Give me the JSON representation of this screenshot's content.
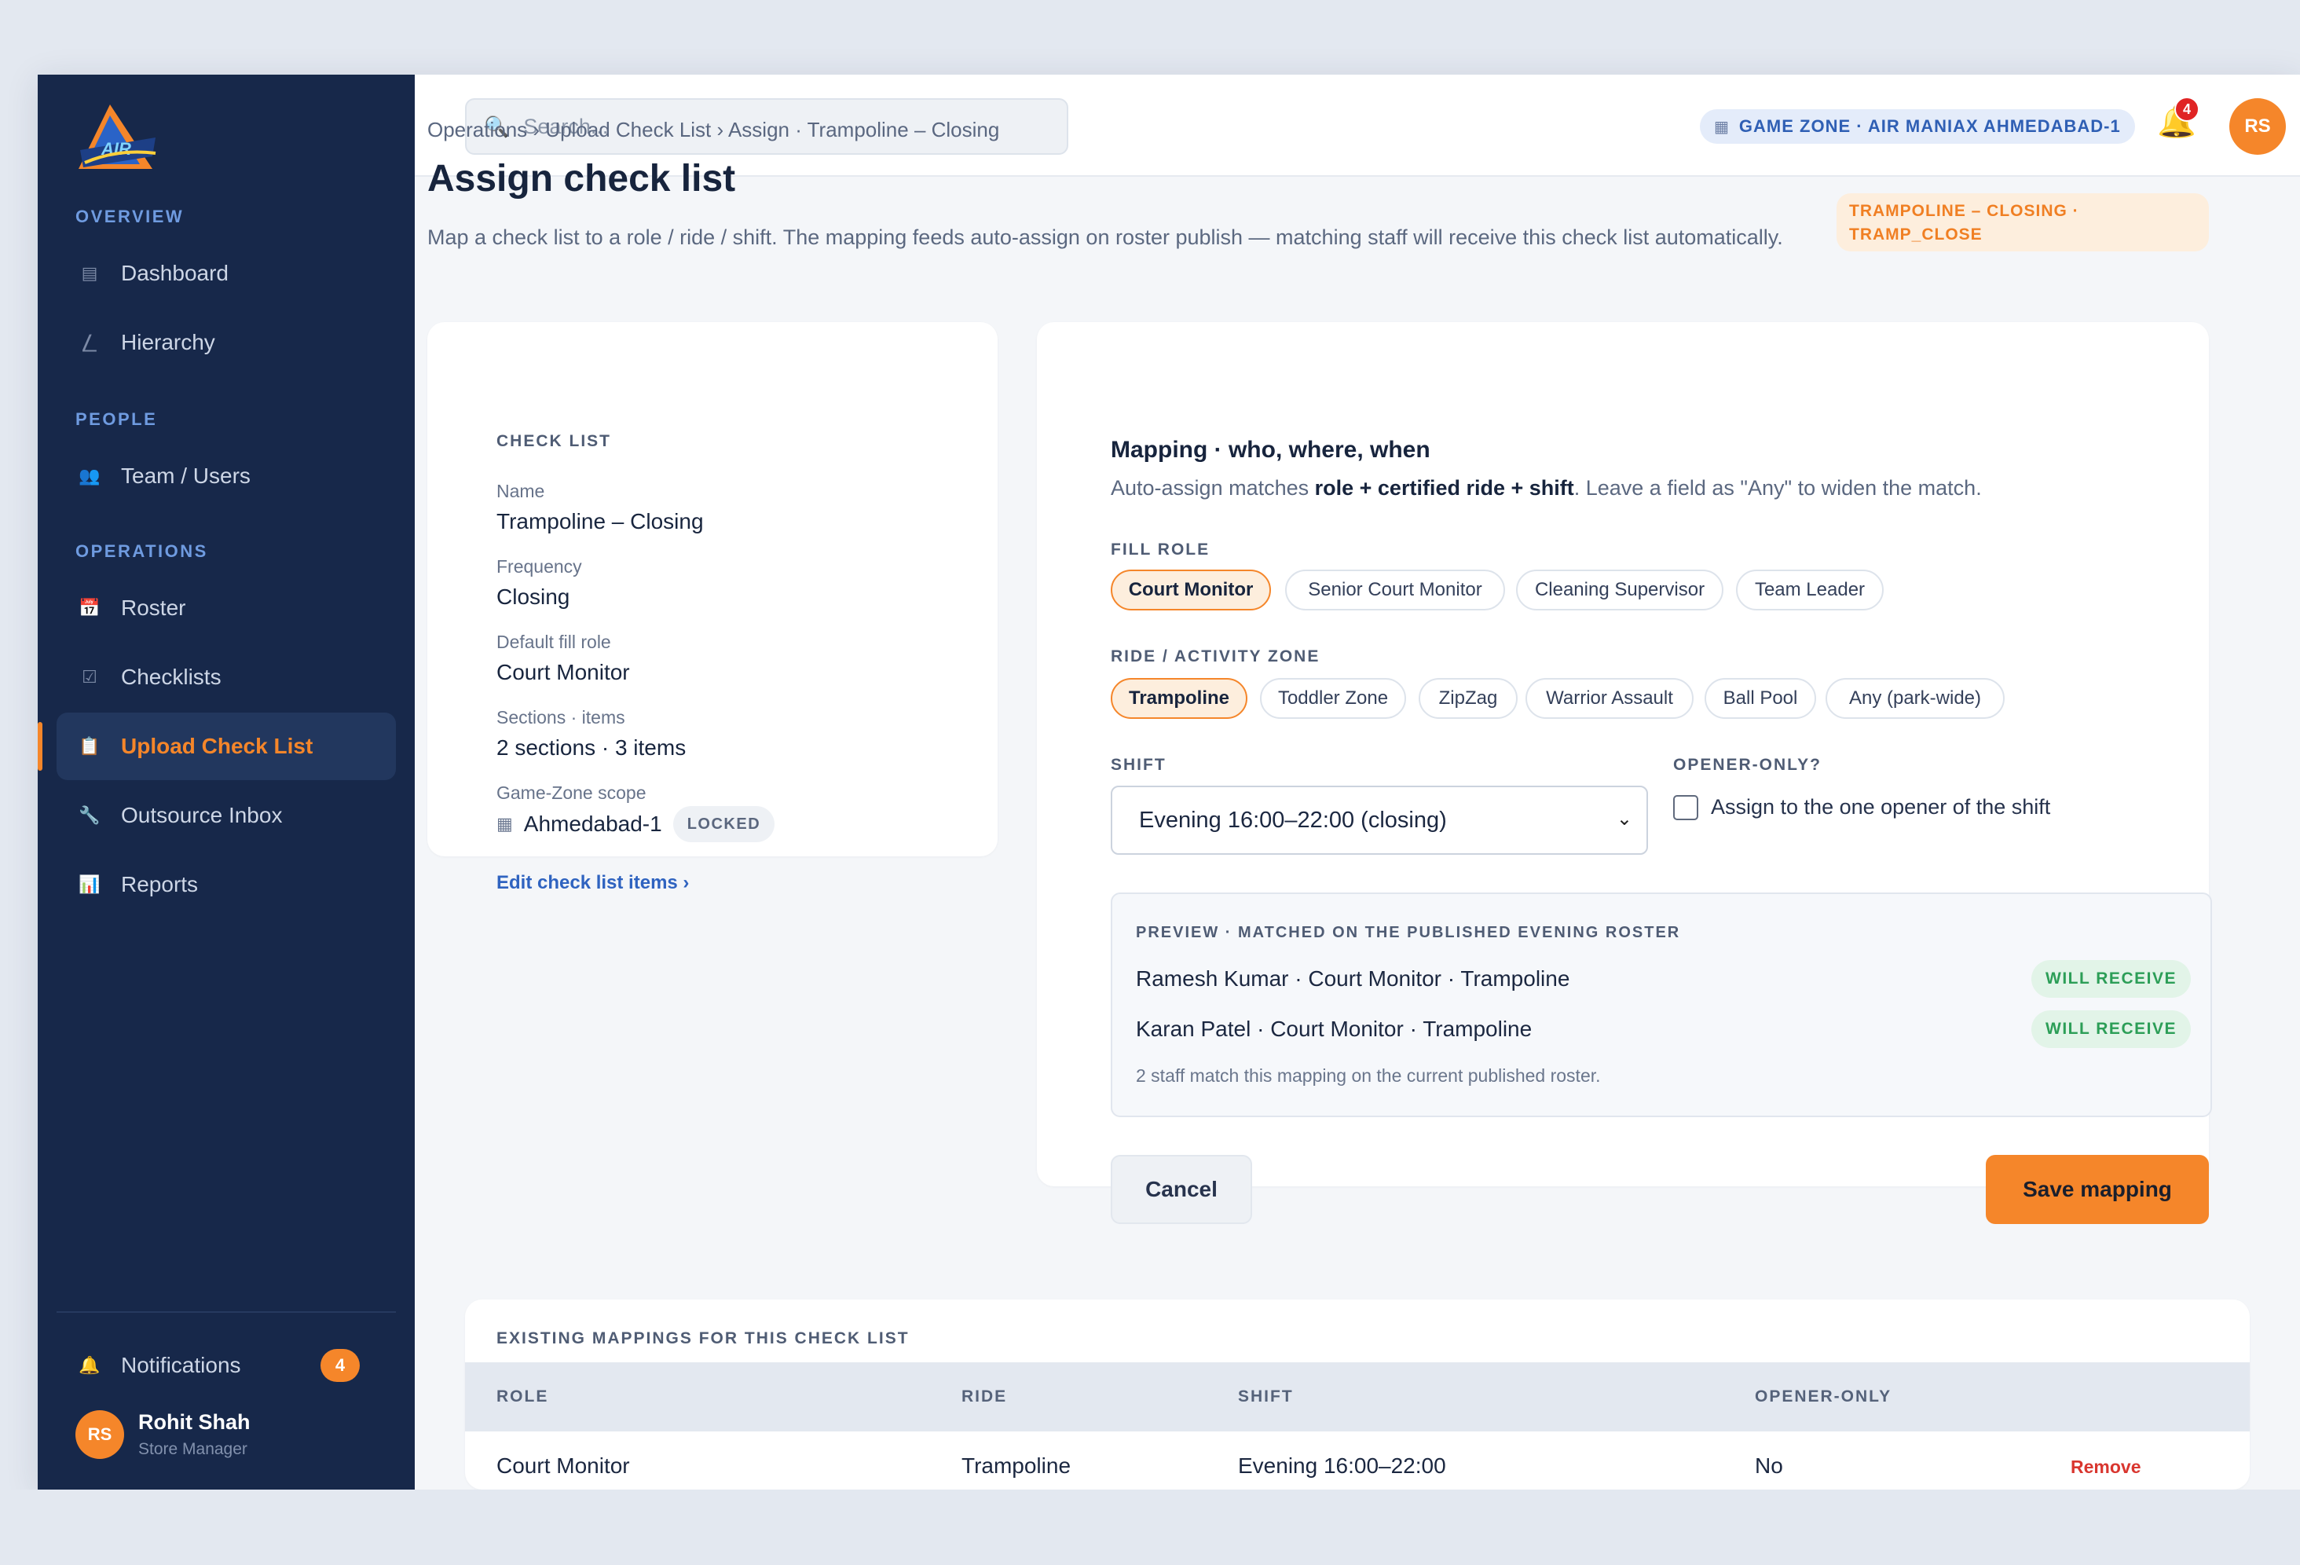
{
  "sidebar": {
    "sections": [
      "OVERVIEW",
      "PEOPLE",
      "OPERATIONS"
    ],
    "items": [
      {
        "label": "Dashboard",
        "icon": "dashboard-icon"
      },
      {
        "label": "Hierarchy",
        "icon": "hierarchy-icon"
      },
      {
        "label": "Team / Users",
        "icon": "team-icon"
      },
      {
        "label": "Roster",
        "icon": "calendar-icon"
      },
      {
        "label": "Checklists",
        "icon": "checkbox-icon"
      },
      {
        "label": "Upload Check List",
        "icon": "clipboard-icon"
      },
      {
        "label": "Outsource Inbox",
        "icon": "wrench-icon"
      },
      {
        "label": "Reports",
        "icon": "chart-icon"
      }
    ],
    "notifications": {
      "label": "Notifications",
      "count": "4"
    },
    "user": {
      "initials": "RS",
      "name": "Rohit Shah",
      "role": "Store Manager"
    }
  },
  "topbar": {
    "search_placeholder": "Search...",
    "zone": "GAME ZONE · AIR MANIAX AHMEDABAD-1",
    "bell_count": "4",
    "avatar_initials": "RS"
  },
  "page": {
    "breadcrumb": "Operations › Upload Check List › Assign · Trampoline – Closing",
    "title": "Assign check list",
    "subtitle": "Map a check list to a role / ride / shift. The mapping feeds auto-assign on roster publish — matching staff will receive this check list automatically.",
    "tag_line1": "TRAMPOLINE – CLOSING ·",
    "tag_line2": "TRAMP_CLOSE"
  },
  "checklist": {
    "caption": "CHECK LIST",
    "name_label": "Name",
    "name": "Trampoline – Closing",
    "freq_label": "Frequency",
    "freq": "Closing",
    "role_label": "Default fill role",
    "role": "Court Monitor",
    "sections_label": "Sections · items",
    "sections": "2 sections · 3 items",
    "scope_label": "Game-Zone scope",
    "scope": "Ahmedabad-1",
    "locked": "LOCKED",
    "edit_link": "Edit check list items ›"
  },
  "mapping": {
    "title": "Mapping · who, where, when",
    "hint_pre": "Auto-assign matches ",
    "hint_bold": "role + certified ride + shift",
    "hint_post": ". Leave a field as \"Any\" to widen the match.",
    "fill_role_label": "FILL ROLE",
    "roles": [
      "Court Monitor",
      "Senior Court Monitor",
      "Cleaning Supervisor",
      "Team Leader"
    ],
    "ride_label": "RIDE / ACTIVITY ZONE",
    "rides": [
      "Trampoline",
      "Toddler Zone",
      "ZipZag",
      "Warrior Assault",
      "Ball Pool",
      "Any (park-wide)"
    ],
    "shift_label": "SHIFT",
    "shift_value": "Evening 16:00–22:00 (closing)",
    "opener_label": "OPENER-ONLY?",
    "opener_text": "Assign to the one opener of the shift",
    "preview_caption": "PREVIEW · MATCHED ON THE PUBLISHED EVENING ROSTER",
    "preview_rows": [
      {
        "text": "Ramesh Kumar · Court Monitor · Trampoline",
        "status": "WILL RECEIVE"
      },
      {
        "text": "Karan Patel · Court Monitor · Trampoline",
        "status": "WILL RECEIVE"
      }
    ],
    "preview_note": "2 staff match this mapping on the current published roster.",
    "cancel": "Cancel",
    "save": "Save mapping"
  },
  "existing": {
    "caption": "EXISTING MAPPINGS FOR THIS CHECK LIST",
    "headers": [
      "ROLE",
      "RIDE",
      "SHIFT",
      "OPENER-ONLY"
    ],
    "rows": [
      {
        "role": "Court Monitor",
        "ride": "Trampoline",
        "shift": "Evening 16:00–22:00",
        "opener": "No",
        "action": "Remove"
      }
    ]
  },
  "colors": {
    "accent": "#f5862a",
    "sidebar": "#17284a",
    "success": "#2c9e57",
    "danger": "#d9362f",
    "link": "#2f63c0"
  }
}
